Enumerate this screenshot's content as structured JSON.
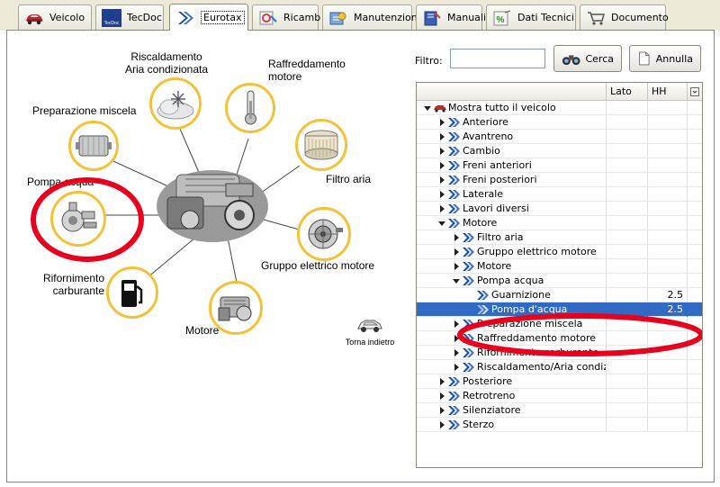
{
  "tabs": [
    {
      "label": "Veicolo",
      "icon": "car-icon"
    },
    {
      "label": "TecDoc",
      "icon": "tecdoc-logo-icon",
      "logo_text": "TecDoc"
    },
    {
      "label": "Eurotax",
      "icon": "eurotax-arrow-icon",
      "active": true
    },
    {
      "label": "Ricamb",
      "icon": "spare-parts-icon"
    },
    {
      "label": "Manutenzione",
      "icon": "maintenance-icon"
    },
    {
      "label": "Manuali",
      "icon": "manual-icon"
    },
    {
      "label": "Dati Tecnici",
      "icon": "technical-data-icon"
    },
    {
      "label": "Documento",
      "icon": "cart-icon"
    }
  ],
  "diagram": {
    "labels": {
      "riscaldamento": "Riscaldamento\nAria condizionata",
      "raffreddamento": "Raffreddamento\nmotore",
      "preparazione": "Preparazione miscela",
      "filtro": "Filtro aria",
      "pompa": "Pompa acqua",
      "gruppo": "Gruppo elettrico motore",
      "rifornimento": "Rifornimento\ncarburante",
      "motore": "Motore"
    },
    "back_label": "Torna indietro"
  },
  "filter": {
    "label": "Filtro:",
    "value": "",
    "search_label": "Cerca",
    "cancel_label": "Annulla"
  },
  "tree": {
    "columns": {
      "lato": "Lato",
      "hh": "HH"
    },
    "rows": [
      {
        "label": "Mostra tutto il veicolo",
        "level": 0,
        "expander": "open",
        "icon": "car",
        "lato": "",
        "hh": ""
      },
      {
        "label": "Anteriore",
        "level": 1,
        "expander": "closed",
        "lato": "",
        "hh": ""
      },
      {
        "label": "Avantreno",
        "level": 1,
        "expander": "closed",
        "lato": "",
        "hh": ""
      },
      {
        "label": "Cambio",
        "level": 1,
        "expander": "closed",
        "lato": "",
        "hh": ""
      },
      {
        "label": "Freni anteriori",
        "level": 1,
        "expander": "closed",
        "lato": "",
        "hh": ""
      },
      {
        "label": "Freni posteriori",
        "level": 1,
        "expander": "closed",
        "lato": "",
        "hh": ""
      },
      {
        "label": "Laterale",
        "level": 1,
        "expander": "closed",
        "lato": "",
        "hh": ""
      },
      {
        "label": "Lavori diversi",
        "level": 1,
        "expander": "closed",
        "lato": "",
        "hh": ""
      },
      {
        "label": "Motore",
        "level": 1,
        "expander": "open",
        "lato": "",
        "hh": ""
      },
      {
        "label": "Filtro aria",
        "level": 2,
        "expander": "closed",
        "lato": "",
        "hh": ""
      },
      {
        "label": "Gruppo elettrico motore",
        "level": 2,
        "expander": "closed",
        "lato": "",
        "hh": ""
      },
      {
        "label": "Motore",
        "level": 2,
        "expander": "closed",
        "lato": "",
        "hh": ""
      },
      {
        "label": "Pompa acqua",
        "level": 2,
        "expander": "open",
        "lato": "",
        "hh": ""
      },
      {
        "label": "Guarnizione",
        "level": 3,
        "expander": "none",
        "lato": "",
        "hh": "2.5"
      },
      {
        "label": "Pompa d'acqua",
        "level": 3,
        "expander": "none",
        "lato": "",
        "hh": "2.5",
        "selected": true
      },
      {
        "label": "Preparazione miscela",
        "level": 2,
        "expander": "closed",
        "lato": "",
        "hh": ""
      },
      {
        "label": "Raffreddamento motore",
        "level": 2,
        "expander": "closed",
        "lato": "",
        "hh": ""
      },
      {
        "label": "Rifornimento carburante",
        "level": 2,
        "expander": "closed",
        "lato": "",
        "hh": ""
      },
      {
        "label": "Riscaldamento/Aria condizio",
        "level": 2,
        "expander": "closed",
        "lato": "",
        "hh": ""
      },
      {
        "label": "Posteriore",
        "level": 1,
        "expander": "closed",
        "lato": "",
        "hh": ""
      },
      {
        "label": "Retrotreno",
        "level": 1,
        "expander": "closed",
        "lato": "",
        "hh": ""
      },
      {
        "label": "Silenziatore",
        "level": 1,
        "expander": "closed",
        "lato": "",
        "hh": ""
      },
      {
        "label": "Sterzo",
        "level": 1,
        "expander": "closed",
        "lato": "",
        "hh": ""
      }
    ]
  },
  "colors": {
    "accent_yellow": "#f3c23a",
    "highlight_red": "#e8001c",
    "selection_blue": "#316ac5",
    "node_arrow_blue": "#1b4fa8"
  }
}
